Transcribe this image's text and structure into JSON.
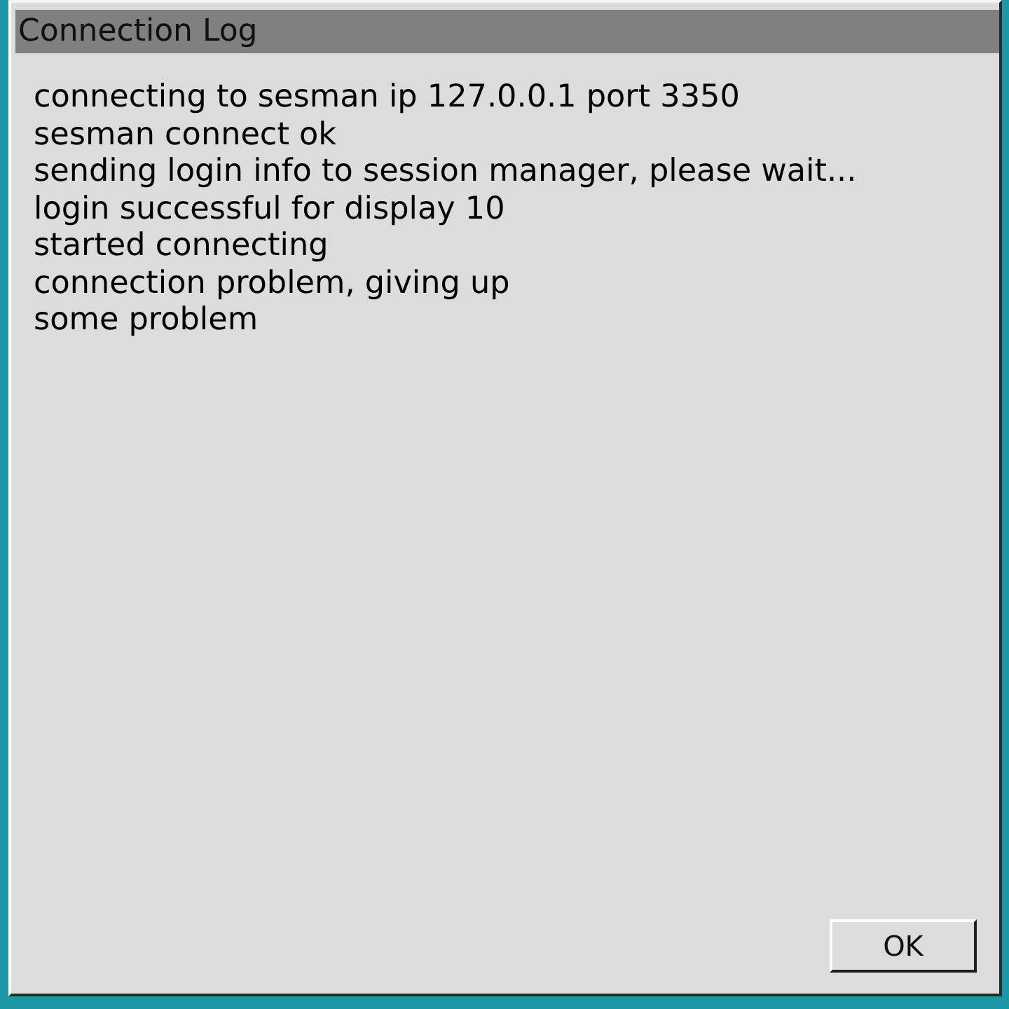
{
  "window": {
    "title": "Connection Log"
  },
  "log_lines": [
    "connecting to sesman ip 127.0.0.1 port 3350",
    "sesman connect ok",
    "sending login info to session manager, please wait...",
    "login successful for display 10",
    "started connecting",
    "connection problem, giving up",
    "some problem"
  ],
  "buttons": [
    "OK"
  ]
}
